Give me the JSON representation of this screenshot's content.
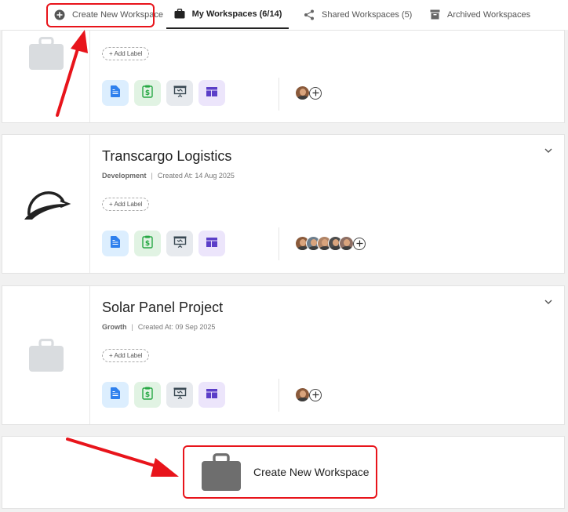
{
  "tabs": {
    "create_label": "Create New Workspace",
    "mine_label": "My Workspaces (6/14)",
    "shared_label": "Shared Workspaces (5)",
    "archived_label": "Archived Workspaces"
  },
  "workspaces": [
    {
      "title": "",
      "add_label": "+ Add Label",
      "members": 1
    },
    {
      "title": "Transcargo Logistics",
      "category": "Development",
      "separator": "|",
      "created": "Created At: 14 Aug 2025",
      "add_label": "+ Add Label",
      "members": 5
    },
    {
      "title": "Solar Panel Project",
      "category": "Growth",
      "separator": "|",
      "created": "Created At: 09 Sep 2025",
      "add_label": "+ Add Label",
      "members": 1
    }
  ],
  "create_card": {
    "label": "Create New Workspace"
  },
  "colors": {
    "highlight": "#e8141b",
    "doc_icon": "#2f80ed",
    "finance_icon": "#27a844",
    "presentation_icon": "#3b4a54",
    "board_icon": "#5b3ec8",
    "bag_placeholder": "#d9dcdf",
    "bag_dark": "#6e6e6e"
  },
  "icons": {
    "create": "plus-circle-icon",
    "mine": "briefcase-icon",
    "shared": "share-icon",
    "archived": "archive-icon",
    "apps": [
      "document-icon",
      "invoice-icon",
      "presentation-icon",
      "board-icon"
    ]
  }
}
